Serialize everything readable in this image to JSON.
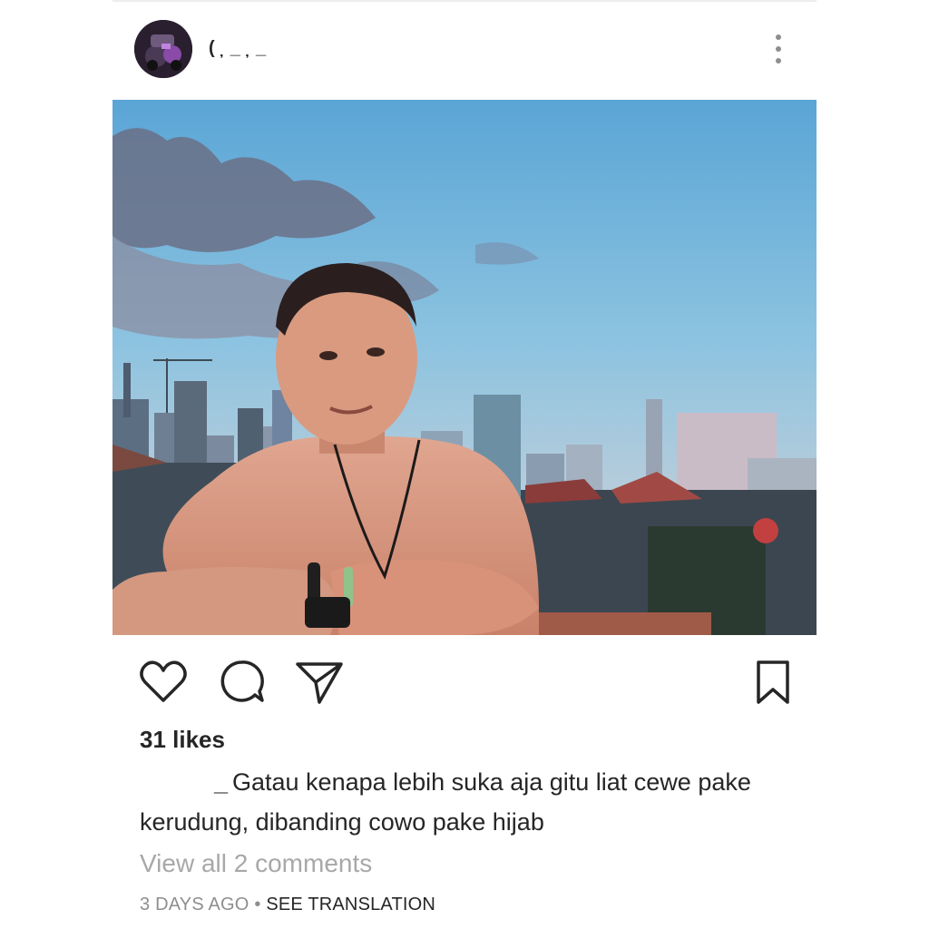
{
  "post": {
    "username": "( ̦ _ ̦ _",
    "likes_text": "31 likes",
    "caption_user": "_",
    "caption_text": "Gatau kenapa lebih suka aja gitu liat cewe pake kerudung, dibanding cowo pake hijab",
    "view_comments": "View all 2 comments",
    "timestamp": "3 DAYS AGO",
    "separator": "•",
    "translation_link": "SEE TRANSLATION"
  },
  "icons": {
    "more": "more-options-icon",
    "like": "heart-icon",
    "comment": "comment-bubble-icon",
    "share": "paper-plane-icon",
    "save": "bookmark-icon"
  },
  "colors": {
    "text": "#262626",
    "muted": "#8e8e8e",
    "faint": "#a8a8a8"
  }
}
